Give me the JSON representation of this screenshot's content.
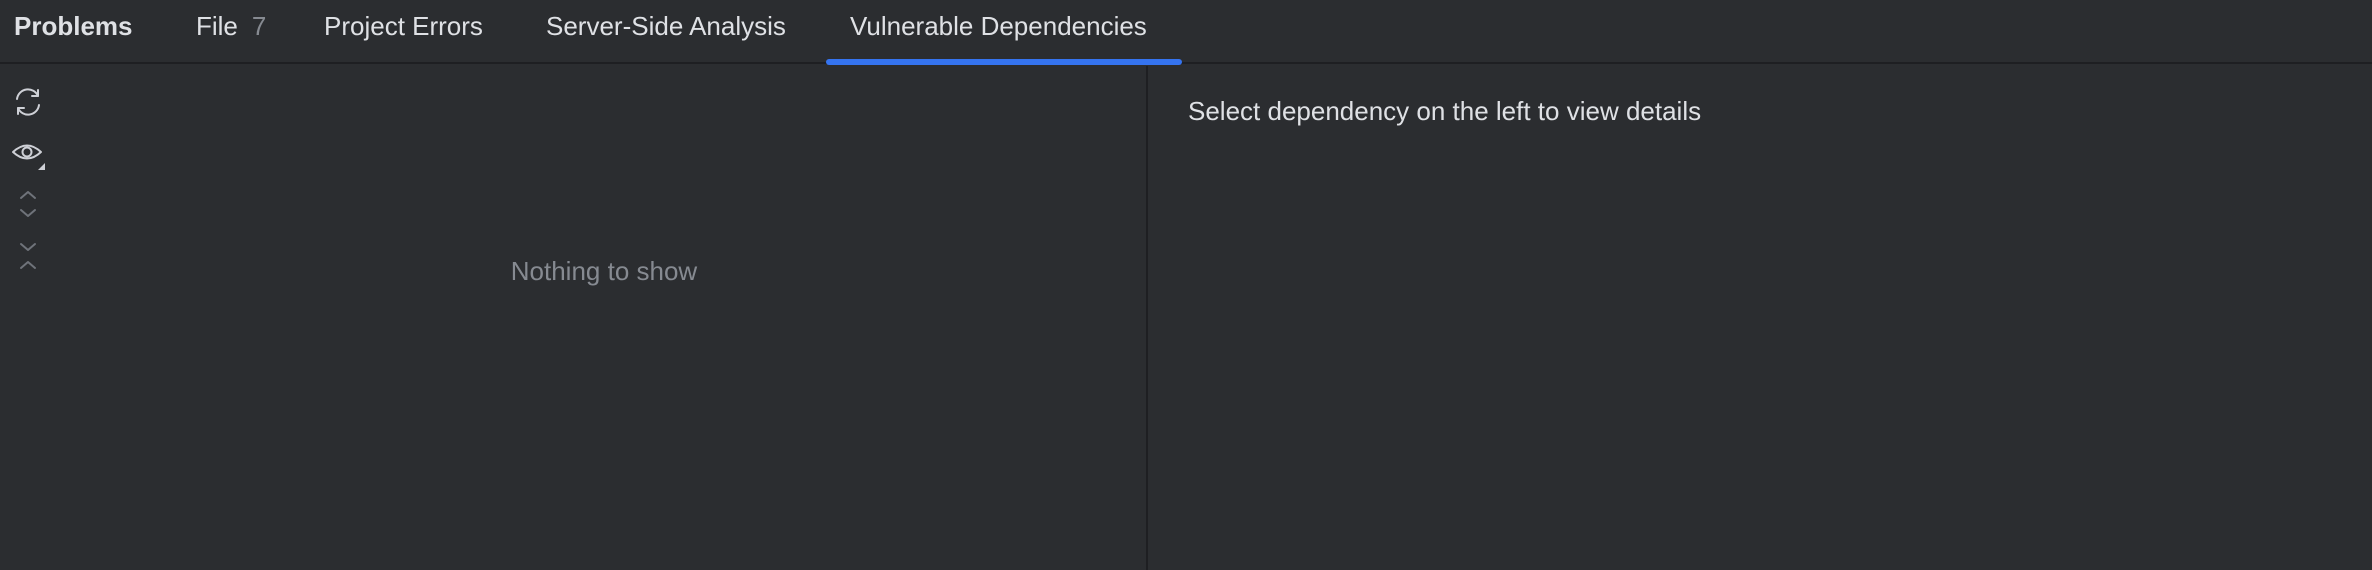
{
  "panel": {
    "title": "Problems"
  },
  "tabs": [
    {
      "label": "File",
      "count": "7"
    },
    {
      "label": "Project Errors"
    },
    {
      "label": "Server-Side Analysis"
    },
    {
      "label": "Vulnerable Dependencies",
      "selected": true
    }
  ],
  "toolbar": {
    "icons": [
      "refresh-icon",
      "eye-icon",
      "expand-all-icon",
      "collapse-all-icon"
    ]
  },
  "tree": {
    "empty_text": "Nothing to show"
  },
  "details": {
    "message": "Select dependency on the left to view details"
  },
  "colors": {
    "background": "#2b2d30",
    "border": "#1e1f22",
    "text": "#dfe1e5",
    "muted_text": "#868a91",
    "accent": "#3574f0"
  }
}
